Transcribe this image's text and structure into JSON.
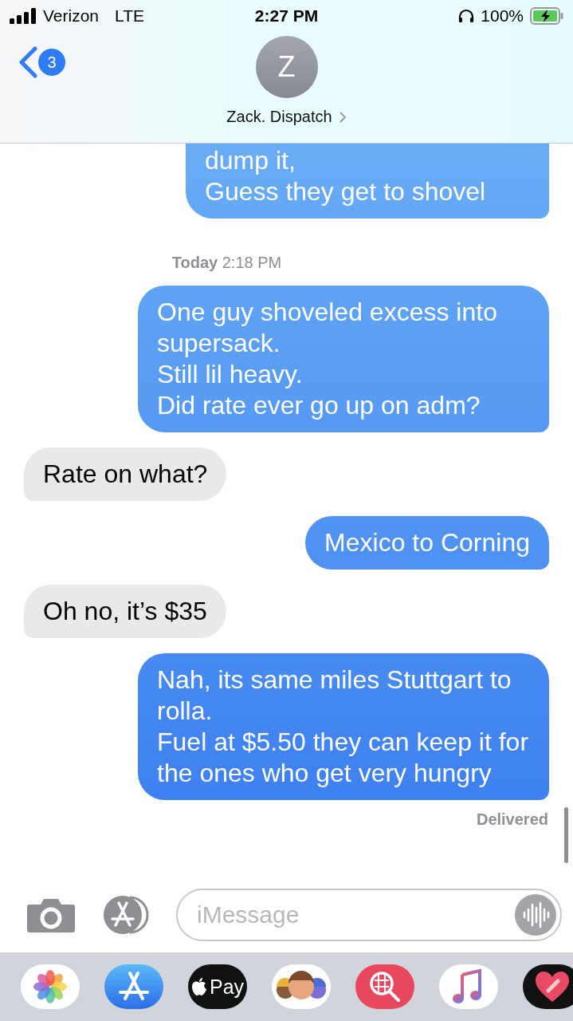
{
  "status_bar": {
    "carrier": "Verizon",
    "network": "LTE",
    "time": "2:27 PM",
    "battery": "100%"
  },
  "header": {
    "back_badge": "3",
    "avatar_initial": "Z",
    "contact": "Zack. Dispatch"
  },
  "messages": [
    {
      "kind": "sent",
      "text": "dump it,\nGuess they get to shovel"
    },
    {
      "kind": "timestamp",
      "text": "**Today** 2:18 PM"
    },
    {
      "kind": "sent",
      "text": "One guy shoveled excess into supersack.\nStill lil heavy.\nDid rate ever go up on adm?"
    },
    {
      "kind": "received",
      "text": "Rate on what?"
    },
    {
      "kind": "sent",
      "text": "Mexico to Corning"
    },
    {
      "kind": "received",
      "text": "Oh no, it’s $35"
    },
    {
      "kind": "sent",
      "text": "Nah, its same miles Stuttgart to rolla.\nFuel at $5.50 they can keep it for the ones who get very hungry"
    }
  ],
  "delivery_status": "Delivered",
  "composer": {
    "placeholder": "iMessage"
  },
  "app_drawer": {
    "apple_pay_label": "Pay"
  }
}
